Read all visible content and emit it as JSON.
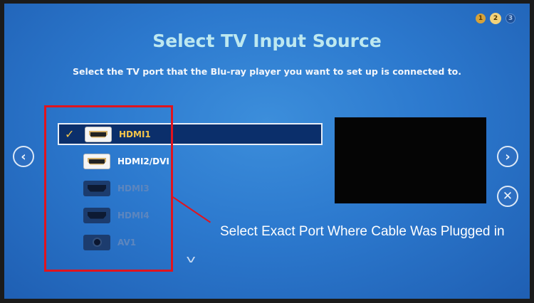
{
  "wizard": {
    "steps": [
      "1",
      "2",
      "3"
    ],
    "current_step": 2,
    "title": "Select TV Input Source",
    "subtitle": "Select the TV port that the Blu-ray player you want to set up is connected to."
  },
  "navigation": {
    "prev_icon": "‹",
    "next_icon": "›",
    "close_icon": "✕",
    "scroll_down_icon": "v"
  },
  "sources": [
    {
      "label": "HDMI1",
      "type": "hdmi",
      "state": "selected",
      "checked": true,
      "check_icon": "✓"
    },
    {
      "label": "HDMI2/DVI",
      "type": "hdmi",
      "state": "active",
      "checked": false,
      "check_icon": "✓"
    },
    {
      "label": "HDMI3",
      "type": "hdmi",
      "state": "inactive",
      "checked": false,
      "check_icon": "✓"
    },
    {
      "label": "HDMI4",
      "type": "hdmi",
      "state": "inactive",
      "checked": false,
      "check_icon": "✓"
    },
    {
      "label": "AV1",
      "type": "av",
      "state": "inactive",
      "checked": false,
      "check_icon": "✓"
    }
  ],
  "annotation": {
    "text": "Select Exact Port Where Cable Was Plugged in",
    "color": "#e0141e"
  },
  "colors": {
    "background": "#2c79ce",
    "title": "#bde8f0",
    "selected_label": "#f3c54a"
  }
}
